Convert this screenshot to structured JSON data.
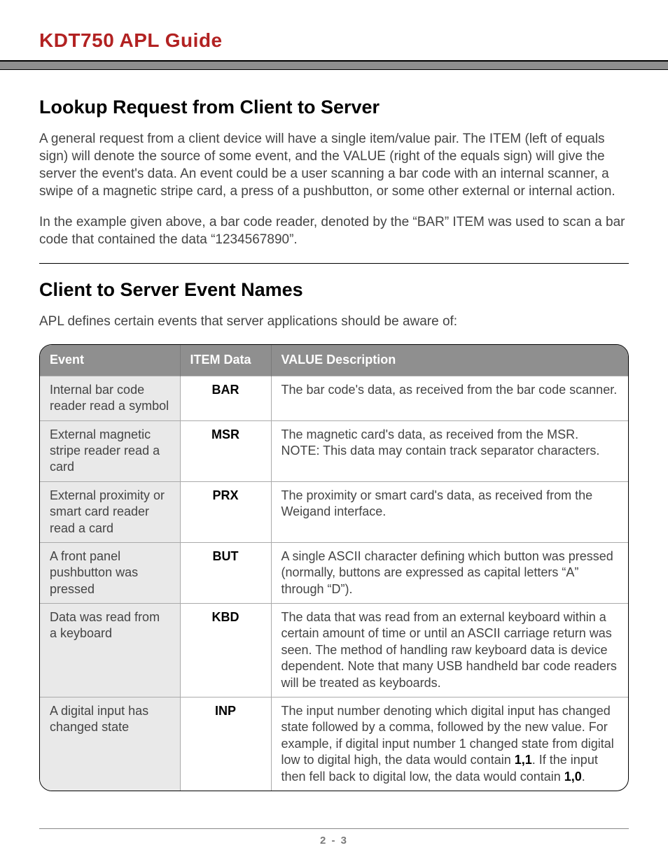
{
  "doc_title": "KDT750 APL Guide",
  "section1": {
    "heading": "Lookup Request from Client to Server",
    "para1": "A general request from a client device will have a single item/value pair. The ITEM (left of equals sign) will denote the source of some event, and the VALUE (right of the equals sign) will give the server the event's data. An event could be a user scanning a bar code with an internal scanner, a swipe of a magnetic stripe card, a press of a pushbutton, or some other external or internal action.",
    "para2": "In the example given above, a bar code reader, denoted by the “BAR” ITEM was used to scan a bar code that contained the data “1234567890”."
  },
  "section2": {
    "heading": "Client to Server Event Names",
    "intro": "APL defines certain events that server applications should be aware of:"
  },
  "table": {
    "headers": {
      "c1": "Event",
      "c2": "ITEM Data",
      "c3": "VALUE Description"
    },
    "rows": [
      {
        "event": "Internal bar code reader read a symbol",
        "item": "BAR",
        "desc": "The bar code's data, as received from the bar code scanner."
      },
      {
        "event": "External magnetic stripe reader read a card",
        "item": "MSR",
        "desc": "The magnetic card's data, as received from the MSR. NOTE: This data may contain track separator characters."
      },
      {
        "event": "External proximity or smart card reader read a card",
        "item": "PRX",
        "desc": "The proximity or smart card's data, as received from the Weigand interface."
      },
      {
        "event": "A front panel pushbutton was pressed",
        "item": "BUT",
        "desc": "A single ASCII character defining which button was pressed (normally, buttons are expressed as capital letters “A” through “D”)."
      },
      {
        "event": "Data was read from a keyboard",
        "item": "KBD",
        "desc": "The data that was read from an external keyboard within a certain amount of time or until an ASCII carriage return was seen. The method of handling raw keyboard data is device dependent. Note that many USB handheld bar code readers will be treated as keyboards."
      },
      {
        "event": "A digital input has changed state",
        "item": "INP",
        "desc_pre": "The input number denoting which digital input has changed state followed by a comma, followed by the new value. For example, if digital input number 1 changed state from digital low to digital high, the data would contain ",
        "desc_b1": "1,1",
        "desc_mid": ". If the input then fell back to digital low, the data would contain ",
        "desc_b2": "1,0",
        "desc_post": "."
      }
    ]
  },
  "page_number": "2 - 3"
}
